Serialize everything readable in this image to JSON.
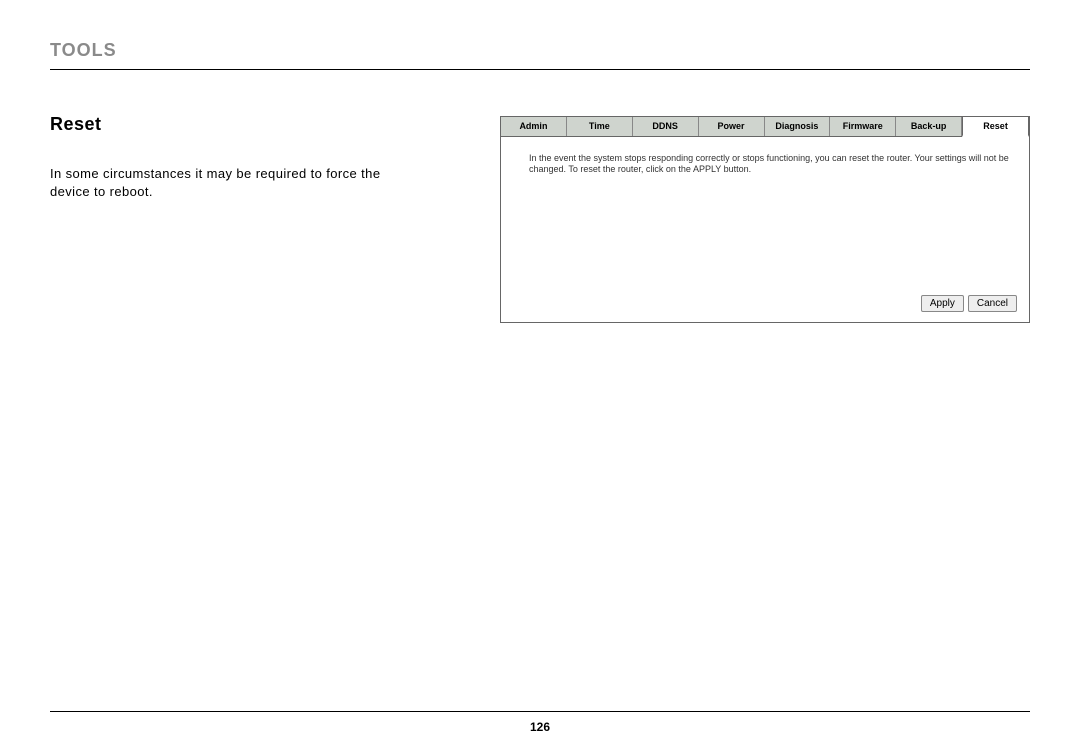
{
  "header": {
    "section_title": "TOOLS"
  },
  "left": {
    "subheading": "Reset",
    "body": "In some circumstances it may be required to force the device to reboot."
  },
  "panel": {
    "tabs": [
      {
        "label": "Admin"
      },
      {
        "label": "Time"
      },
      {
        "label": "DDNS"
      },
      {
        "label": "Power"
      },
      {
        "label": "Diagnosis"
      },
      {
        "label": "Firmware"
      },
      {
        "label": "Back-up"
      },
      {
        "label": "Reset"
      }
    ],
    "active_index": 7,
    "body_text": "In the event the system stops responding correctly or stops functioning, you can reset the router. Your settings will not be changed. To reset the router, click on the APPLY button.",
    "apply_label": "Apply",
    "cancel_label": "Cancel"
  },
  "footer": {
    "page_number": "126"
  }
}
